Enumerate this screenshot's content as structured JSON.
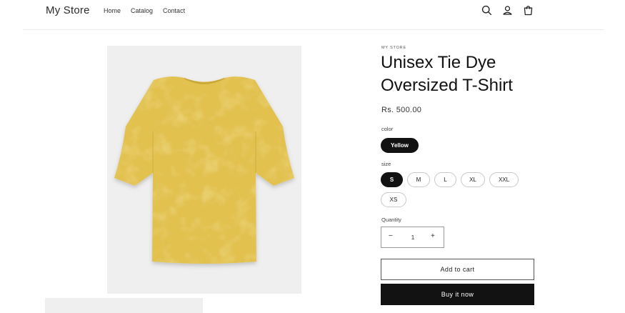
{
  "header": {
    "logo": "My Store",
    "nav": [
      "Home",
      "Catalog",
      "Contact"
    ],
    "icons": [
      "search-icon",
      "account-icon",
      "cart-icon"
    ]
  },
  "product": {
    "vendor": "MY STORE",
    "title_line1": "Unisex Tie Dye",
    "title_line2": "Oversized T-Shirt",
    "price": "Rs. 500.00",
    "color_label": "color",
    "colors": [
      "Yellow"
    ],
    "selected_color": "Yellow",
    "size_label": "size",
    "sizes": [
      "S",
      "M",
      "L",
      "XL",
      "XXL",
      "XS"
    ],
    "selected_size": "S",
    "quantity_label": "Quantity",
    "quantity": "1",
    "minus": "−",
    "plus": "+",
    "add_to_cart": "Add to cart",
    "buy_now": "Buy it now"
  },
  "colors": {
    "accent": "#121212",
    "image_bg": "#efefef",
    "shirt": "#e2c14f"
  }
}
